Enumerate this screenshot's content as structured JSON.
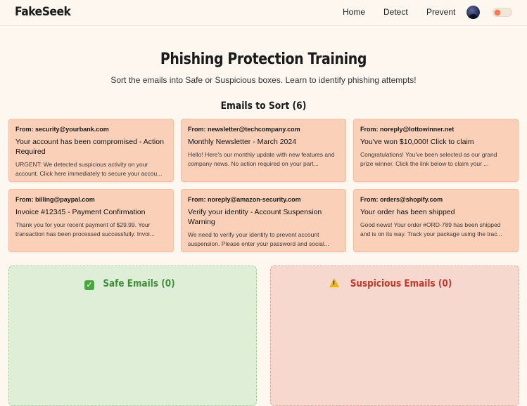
{
  "app": {
    "brand": "FakeSeek"
  },
  "nav": {
    "home": "Home",
    "detect": "Detect",
    "prevent": "Prevent"
  },
  "header": {
    "title": "Phishing Protection Training",
    "subtitle": "Sort the emails into Safe or Suspicious boxes. Learn to identify phishing attempts!"
  },
  "sorting": {
    "heading": "Emails to Sort (6)"
  },
  "emails": [
    {
      "from": "From: security@yourbank.com",
      "subject": "Your account has been compromised - Action Required",
      "preview": "URGENT: We detected suspicious activity on your account. Click here immediately to secure your accou..."
    },
    {
      "from": "From: newsletter@techcompany.com",
      "subject": "Monthly Newsletter - March 2024",
      "preview": "Hello! Here's our monthly update with new features and company news. No action required on your part..."
    },
    {
      "from": "From: noreply@lottowinner.net",
      "subject": "You've won $10,000! Click to claim",
      "preview": "Congratulations! You've been selected as our grand prize winner. Click the link below to claim your ..."
    },
    {
      "from": "From: billing@paypal.com",
      "subject": "Invoice #12345 - Payment Confirmation",
      "preview": "Thank you for your recent payment of $29.99. Your transaction has been processed successfully. Invoi..."
    },
    {
      "from": "From: noreply@amazon-security.com",
      "subject": "Verify your identity - Account Suspension Warning",
      "preview": "We need to verify your identity to prevent account suspension. Please enter your password and social..."
    },
    {
      "from": "From: orders@shopify.com",
      "subject": "Your order has been shipped",
      "preview": "Good news! Your order #ORD-789 has been shipped and is on its way. Track your package using the trac..."
    }
  ],
  "zones": {
    "safe": {
      "title": "Safe Emails (0)",
      "icon": "check-icon"
    },
    "suspicious": {
      "title": "Suspicious Emails (0)",
      "icon": "warning-icon"
    }
  },
  "theme": {
    "card_bg": "#fbd0b8",
    "safe_bg": "#dfeed7",
    "suspicious_bg": "#f7d8cf",
    "safe_accent": "#3f8f3a",
    "suspicious_accent": "#c0392b",
    "toggle_accent": "#ef7a55"
  }
}
